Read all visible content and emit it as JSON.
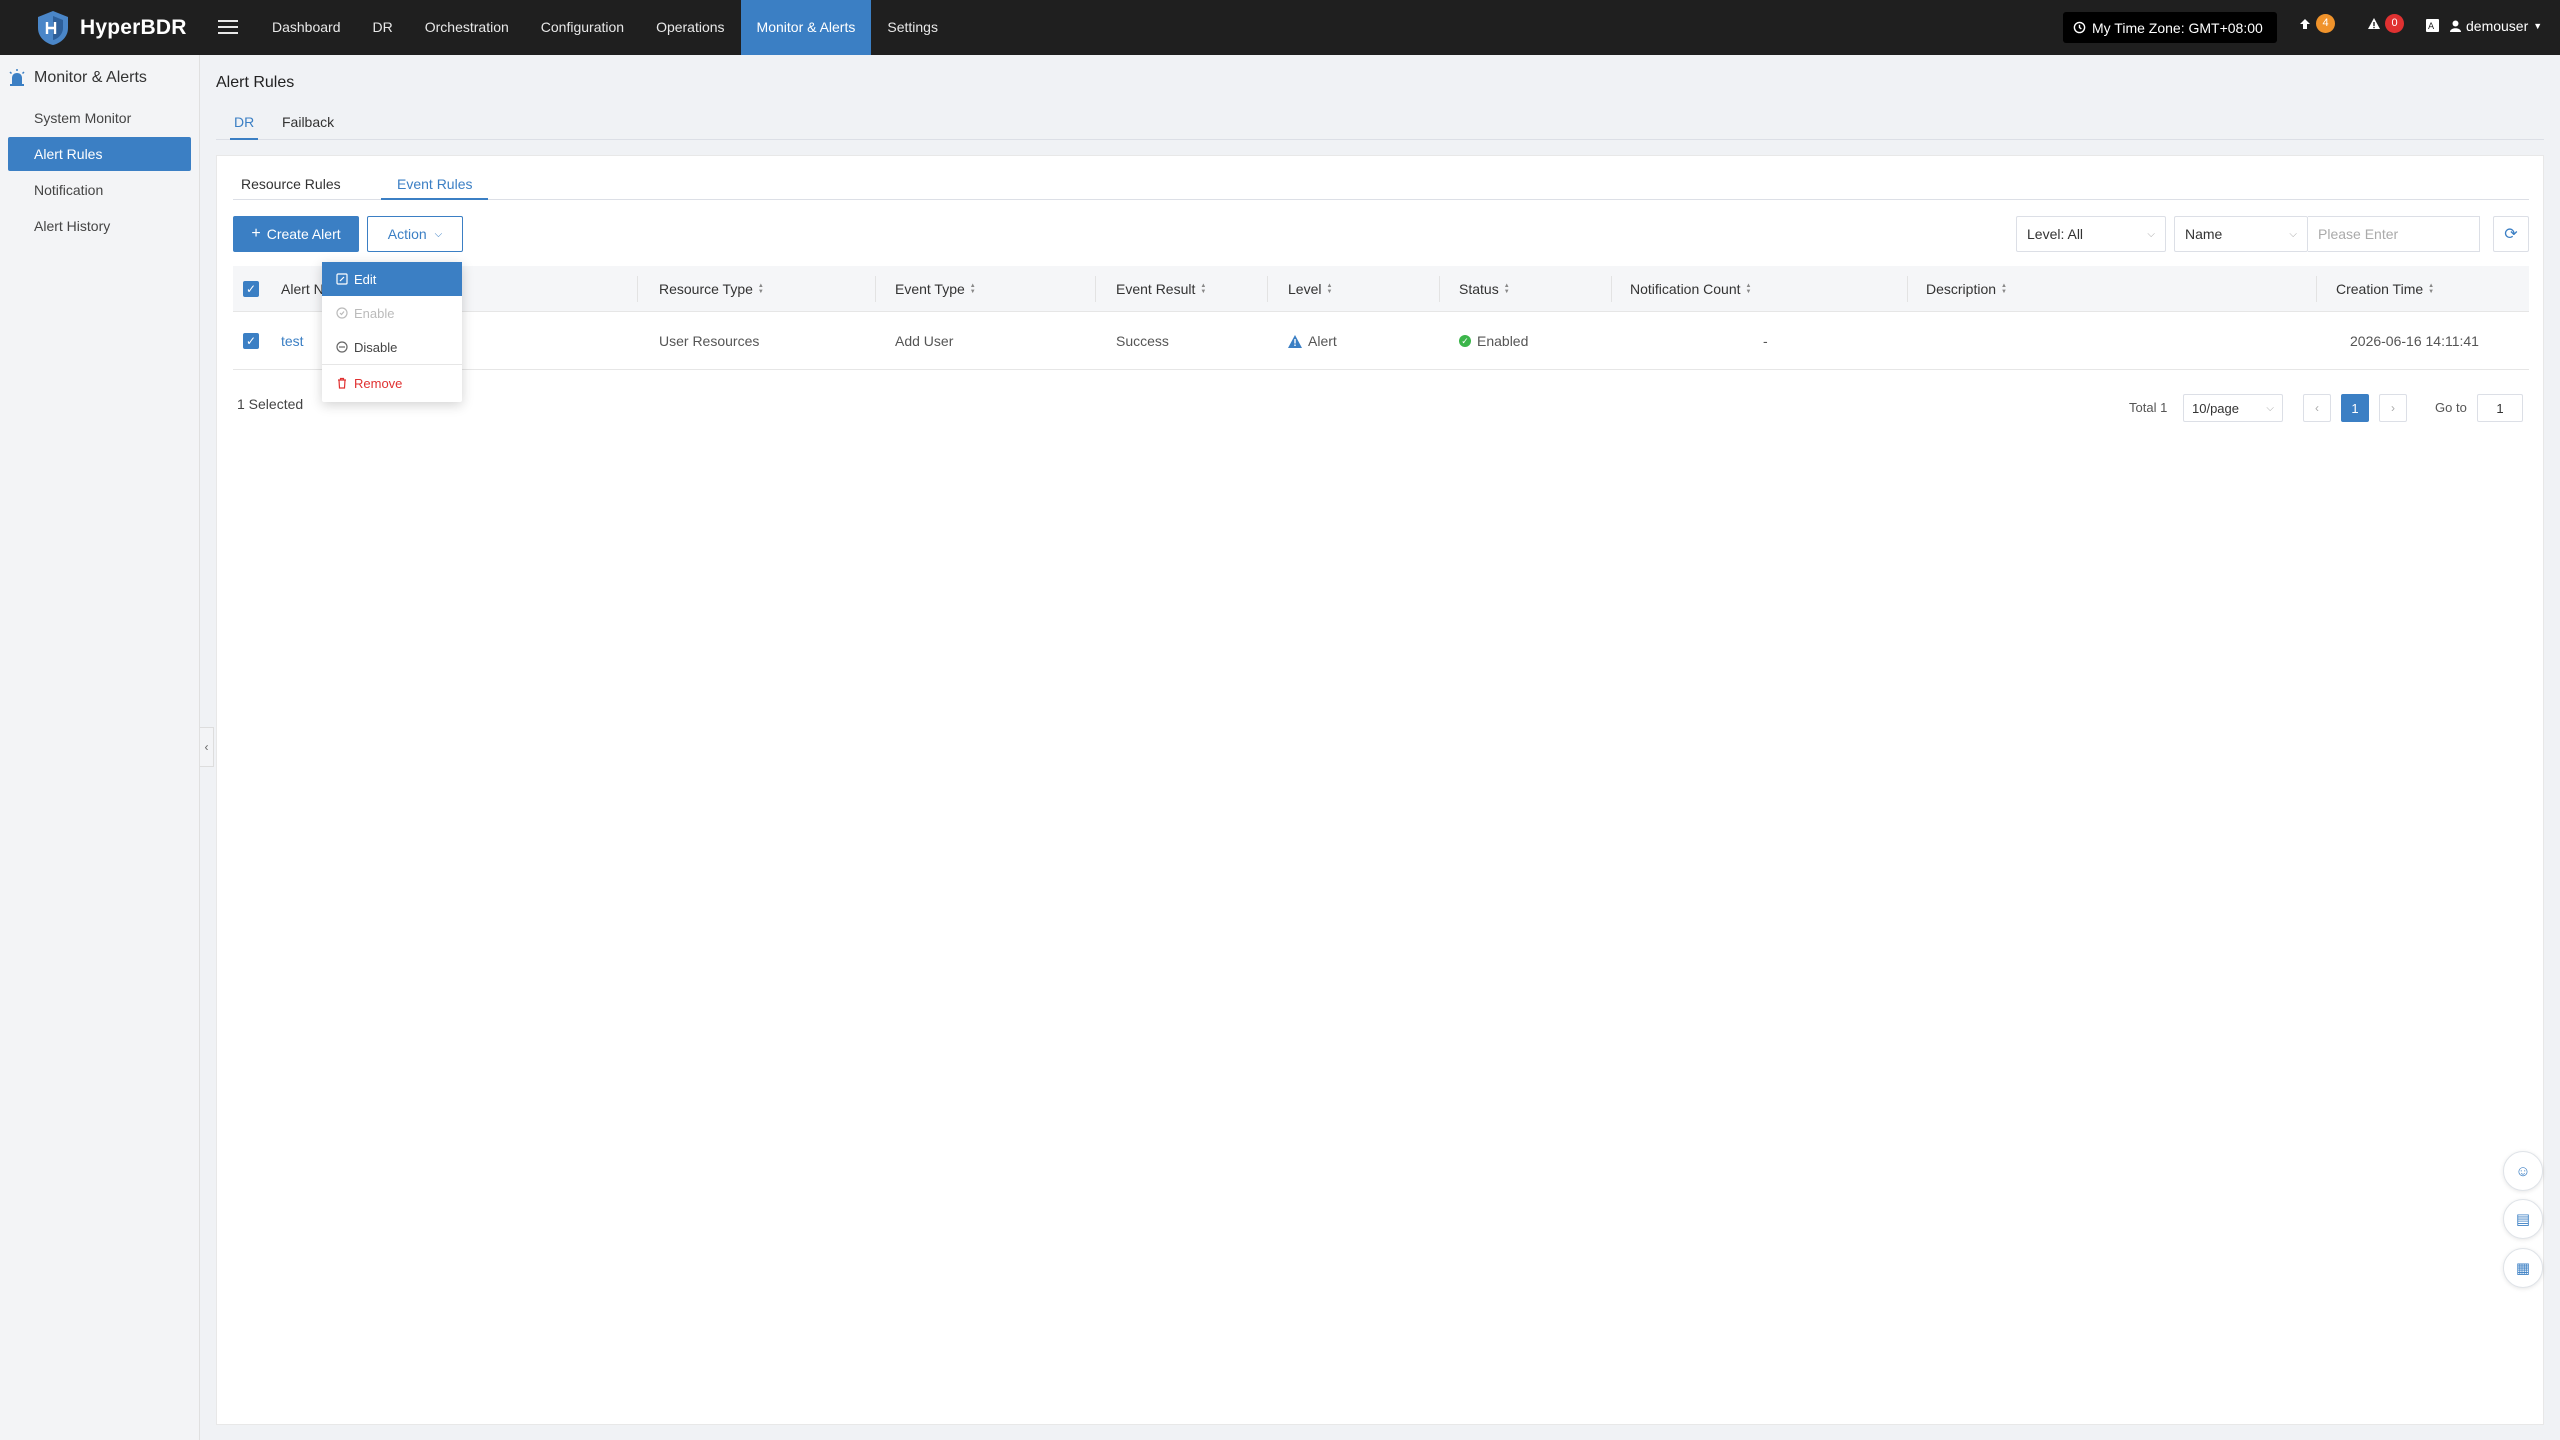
{
  "app": {
    "name": "HyperBDR"
  },
  "topnav": {
    "items": [
      {
        "label": "Dashboard",
        "active": false
      },
      {
        "label": "DR",
        "active": false
      },
      {
        "label": "Orchestration",
        "active": false
      },
      {
        "label": "Configuration",
        "active": false
      },
      {
        "label": "Operations",
        "active": false
      },
      {
        "label": "Monitor & Alerts",
        "active": true
      },
      {
        "label": "Settings",
        "active": false
      }
    ]
  },
  "header": {
    "timezone": "My Time Zone: GMT+08:00",
    "upgrade_count": "4",
    "alert_count": "0",
    "username": "demouser"
  },
  "sidebar": {
    "title": "Monitor & Alerts",
    "items": [
      {
        "label": "System Monitor",
        "active": false
      },
      {
        "label": "Alert Rules",
        "active": true
      },
      {
        "label": "Notification",
        "active": false
      },
      {
        "label": "Alert History",
        "active": false
      }
    ]
  },
  "page": {
    "title": "Alert Rules",
    "outer_tabs": [
      {
        "label": "DR",
        "active": true
      },
      {
        "label": "Failback",
        "active": false
      }
    ],
    "inner_tabs": [
      {
        "label": "Resource Rules",
        "active": false
      },
      {
        "label": "Event Rules",
        "active": true
      }
    ]
  },
  "toolbar": {
    "create_label": "Create Alert",
    "action_label": "Action",
    "level_filter": "Level: All",
    "field_select": "Name",
    "search_placeholder": "Please Enter"
  },
  "table": {
    "columns": [
      "Alert N",
      "Resource Type",
      "Event Type",
      "Event Result",
      "Level",
      "Status",
      "Notification Count",
      "Description",
      "Creation Time"
    ],
    "rows": [
      {
        "name": "test",
        "resource_type": "User Resources",
        "event_type": "Add User",
        "event_result": "Success",
        "level": "Alert",
        "status": "Enabled",
        "notification_count": "-",
        "description": "",
        "creation_time": "2026-06-16 14:11:41"
      }
    ]
  },
  "footer": {
    "selected": "1 Selected",
    "total": "Total 1",
    "page_size": "10/page",
    "current_page": "1",
    "goto_label": "Go to",
    "goto_value": "1"
  },
  "action_menu": {
    "items": [
      {
        "label": "Edit",
        "state": "highlighted"
      },
      {
        "label": "Enable",
        "state": "disabled"
      },
      {
        "label": "Disable",
        "state": "normal"
      },
      {
        "label": "Remove",
        "state": "danger"
      }
    ]
  },
  "colors": {
    "accent": "#3b7fc4",
    "topbar": "#1f1f1f",
    "success": "#3bb54a",
    "danger": "#e03131",
    "warning": "#f0932b"
  },
  "icons": {
    "logo": "shield-logo-icon",
    "menu": "hamburger-icon",
    "clock": "clock-icon",
    "upgrade": "arrow-up-icon",
    "alert": "warning-triangle-icon",
    "translate": "language-icon",
    "user": "user-icon",
    "sidebar": "alarm-icon",
    "refresh": "refresh-icon",
    "float": [
      "chat-icon",
      "book-icon",
      "clipboard-icon"
    ]
  }
}
